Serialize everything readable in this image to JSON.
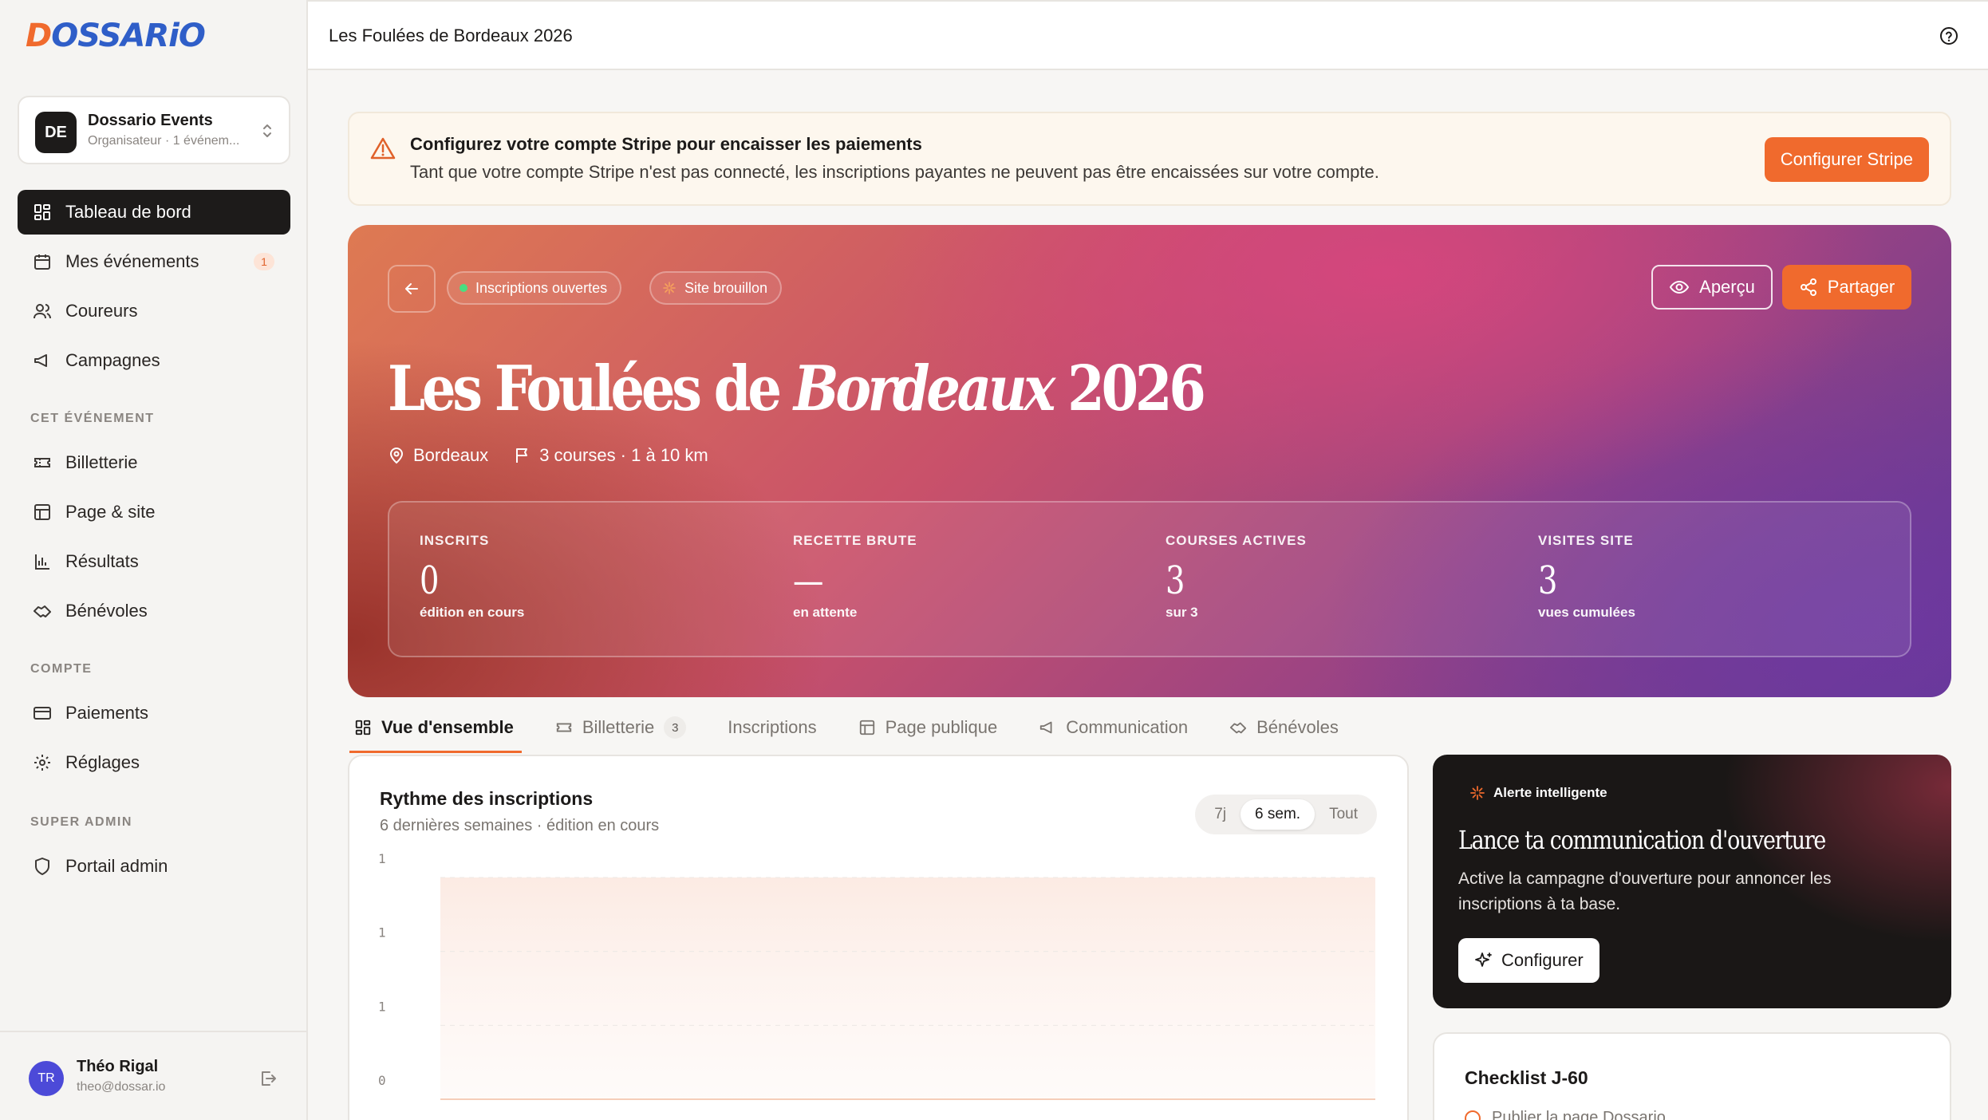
{
  "brand": {
    "logo": "DOSSARiO"
  },
  "org": {
    "initials": "DE",
    "name": "Dossario Events",
    "subtitle": "Organisateur · 1 événem..."
  },
  "nav": {
    "dashboard": "Tableau de bord",
    "events": "Mes événements",
    "events_badge": "1",
    "runners": "Coureurs",
    "campaigns": "Campagnes",
    "section_event": "CET ÉVÉNEMENT",
    "ticketing": "Billetterie",
    "page_site": "Page & site",
    "results": "Résultats",
    "volunteers": "Bénévoles",
    "section_account": "COMPTE",
    "payments": "Paiements",
    "settings": "Réglages",
    "section_super": "SUPER ADMIN",
    "admin_portal": "Portail admin"
  },
  "user": {
    "initials": "TR",
    "name": "Théo Rigal",
    "email": "theo@dossar.io"
  },
  "topbar": {
    "title": "Les Foulées de Bordeaux 2026"
  },
  "banner": {
    "title": "Configurez votre compte Stripe pour encaisser les paiements",
    "text": "Tant que votre compte Stripe n'est pas connecté, les inscriptions payantes ne peuvent pas être encaissées sur votre compte.",
    "button": "Configurer Stripe"
  },
  "hero": {
    "status_pill": "Inscriptions ouvertes",
    "site_pill": "Site brouillon",
    "preview": "Aperçu",
    "share": "Partager",
    "title_part1": "Les Foulées de ",
    "title_italic": "Bordeaux",
    "title_part2": " 2026",
    "location": "Bordeaux",
    "courses": "3 courses · 1 à 10 km",
    "stats": [
      {
        "label": "INSCRITS",
        "value": "0",
        "sub": "édition en cours"
      },
      {
        "label": "RECETTE BRUTE",
        "value": "—",
        "sub": "en attente"
      },
      {
        "label": "COURSES ACTIVES",
        "value": "3",
        "sub": "sur 3"
      },
      {
        "label": "VISITES SITE",
        "value": "3",
        "sub": "vues cumulées"
      }
    ]
  },
  "tabs": {
    "overview": "Vue d'ensemble",
    "ticketing": "Billetterie",
    "ticketing_count": "3",
    "registrations": "Inscriptions",
    "public_page": "Page publique",
    "communication": "Communication",
    "volunteers": "Bénévoles"
  },
  "chart": {
    "title": "Rythme des inscriptions",
    "subtitle": "6 dernières semaines · édition en cours",
    "ranges": [
      "7j",
      "6 sem.",
      "Tout"
    ],
    "selected_range": "6 sem."
  },
  "chart_data": {
    "type": "area",
    "title": "Rythme des inscriptions",
    "xlabel": "",
    "ylabel": "",
    "y_tick_labels": [
      "1",
      "1",
      "1",
      "0"
    ],
    "ylim": [
      0,
      1
    ],
    "grid": true,
    "series": [
      {
        "values": [
          0,
          0,
          0,
          0,
          0,
          0
        ]
      }
    ]
  },
  "alert": {
    "tag": "Alerte intelligente",
    "title": "Lance ta communication d'ouverture",
    "text": "Active la campagne d'ouverture pour annoncer les inscriptions à ta base.",
    "button": "Configurer"
  },
  "checklist": {
    "title": "Checklist J-60",
    "first_item": "Publier la page Dossario"
  },
  "colors": {
    "accent": "#f06a2d",
    "dark": "#1d1b1a",
    "brand_blue": "#2f5ec8"
  }
}
